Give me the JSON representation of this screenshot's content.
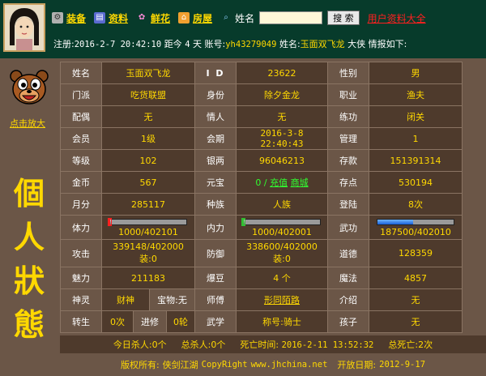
{
  "nav": {
    "equip": "装备",
    "info": "资料",
    "flowers": "鲜花",
    "house": "房屋",
    "name_label": "姓名",
    "search_value": "",
    "search_btn": "搜 索",
    "all_users": "用户资料大全"
  },
  "status": {
    "reg_label": "注册:",
    "reg_date": "2016-2-7 20:42:10",
    "since_label": "距今",
    "since_days": "4",
    "since_unit": "天",
    "account_label": "账号:",
    "account": "yh43279049",
    "name_label": "姓名:",
    "name": "玉面双飞龙",
    "title": "大侠",
    "intel": "情报如下:"
  },
  "left": {
    "enlarge": "点击放大",
    "title": "個人狀態"
  },
  "rows": {
    "r1": [
      "姓名",
      "玉面双飞龙",
      "I D",
      "23622",
      "性别",
      "男"
    ],
    "r2": [
      "门派",
      "吃货联盟",
      "身份",
      "除夕金龙",
      "职业",
      "渔夫"
    ],
    "r3": [
      "配偶",
      "无",
      "情人",
      "无",
      "练功",
      "闭关"
    ],
    "r4": [
      "会员",
      "1级",
      "会期",
      "2016-3-8 22:40:43",
      "管理",
      "1"
    ],
    "r5": [
      "等级",
      "102",
      "银两",
      "96046213",
      "存款",
      "151391314"
    ],
    "r6": [
      "金币",
      "567",
      "元宝",
      "0",
      "存点",
      "530194"
    ],
    "r6_extra": {
      "slash": "/",
      "recharge": "充值",
      "mall": "商城"
    },
    "r7": [
      "月分",
      "285117",
      "种族",
      "人族",
      "登陆",
      "8次"
    ],
    "r8": [
      "体力",
      "1000/402101",
      "内力",
      "1000/402001",
      "武功",
      "187500/402010"
    ],
    "r8_levels": {
      "hp": 0.0025,
      "mp": 0.0025,
      "skill": 0.466
    },
    "r9": [
      "攻击",
      "339148/402000",
      "防御",
      "338600/402000",
      "道德",
      "128359"
    ],
    "r9_extra": {
      "atk_equip": "装:0",
      "def_equip": "装:0"
    },
    "r10": [
      "魅力",
      "211183",
      "爆豆",
      "4 个",
      "魔法",
      "4857"
    ],
    "r11": [
      "神灵",
      "财神",
      "师傅",
      "形同陌路",
      "介绍",
      "无"
    ],
    "r11_extra": {
      "treasure_label": "宝物:",
      "treasure": "无"
    },
    "r12": [
      "转生",
      "0次",
      "武学",
      "称号:骑士",
      "孩子",
      "无"
    ],
    "r12_extra": {
      "jinxiu": "进修",
      "wheel": "0轮"
    }
  },
  "footer": {
    "kills_today": "今日杀人:0个",
    "total_kills": "总杀人:0个",
    "death_label": "死亡时间:",
    "death_time": "2016-2-11 13:52:32",
    "total_deaths": "总死亡:2次",
    "copyright_label": "版权所有:",
    "site_name": "侠剑江湖",
    "copyright_right": "CopyRight",
    "url": "www.jhchina.net",
    "open_label": "开放日期:",
    "open_date": "2012-9-17"
  },
  "colors": {
    "header_bg": "#073b2b",
    "page_bg": "#6b5647",
    "cell_dark": "#4e3a2c",
    "accent": "#ffd800",
    "link_green": "#30ff30",
    "link_red": "#ff2020"
  }
}
